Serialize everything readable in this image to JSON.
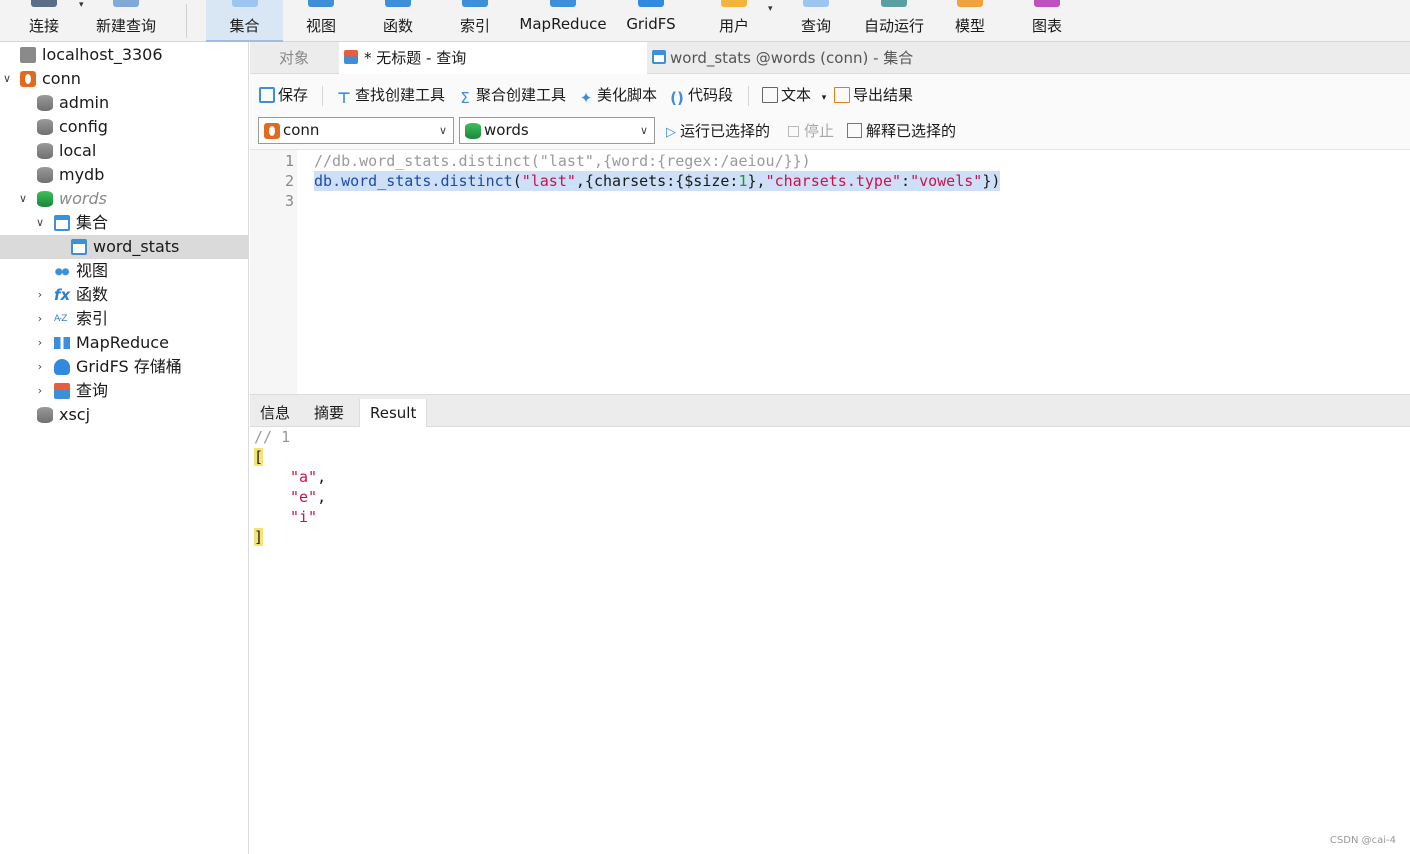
{
  "ribbon": {
    "connect_label": "连接",
    "new_query_label": "新建查询",
    "collection_label": "集合",
    "view_label": "视图",
    "function_label": "函数",
    "index_label": "索引",
    "mapreduce_label": "MapReduce",
    "gridfs_label": "GridFS",
    "user_label": "用户",
    "query_label": "查询",
    "autorun_label": "自动运行",
    "model_label": "模型",
    "chart_label": "图表"
  },
  "tree": {
    "host": "localhost_3306",
    "conn": "conn",
    "dbs": [
      "admin",
      "config",
      "local",
      "mydb"
    ],
    "words": "words",
    "collections": "集合",
    "word_stats": "word_stats",
    "views": "视图",
    "functions": "函数",
    "indexes": "索引",
    "mapreduce": "MapReduce",
    "gridfs": "GridFS 存储桶",
    "queries": "查询",
    "xscj": "xscj"
  },
  "tabs": {
    "objects": "对象",
    "query_tab": "* 无标题 - 查询",
    "collection_tab": "word_stats @words (conn) - 集合"
  },
  "toolbar": {
    "save": "保存",
    "find_builder": "查找创建工具",
    "agg_builder": "聚合创建工具",
    "beautify": "美化脚本",
    "snippet": "代码段",
    "text": "文本",
    "export": "导出结果"
  },
  "selectors": {
    "connection": "conn",
    "database": "words",
    "run_selected": "运行已选择的",
    "stop": "停止",
    "explain_selected": "解释已选择的"
  },
  "editor": {
    "line_numbers": [
      "1",
      "2",
      "3"
    ],
    "line1": "//db.word_stats.distinct(\"last\",{word:{regex:/aeiou/}})",
    "line2": {
      "p1": "db",
      "p2": ".word_stats.",
      "p3": "distinct",
      "p4": "(",
      "p5": "\"last\"",
      "p6": ",{charsets:{$size:",
      "p7": "1",
      "p8": "},",
      "p9": "\"charsets.type\"",
      "p10": ":",
      "p11": "\"vowels\"",
      "p12": "})"
    }
  },
  "result_tabs": {
    "info": "信息",
    "summary": "摘要",
    "result": "Result"
  },
  "result": {
    "comment": "// 1",
    "open": "[",
    "items": [
      "\"a\"",
      "\"e\"",
      "\"i\""
    ],
    "close": "]"
  },
  "watermark": "CSDN @cai-4"
}
